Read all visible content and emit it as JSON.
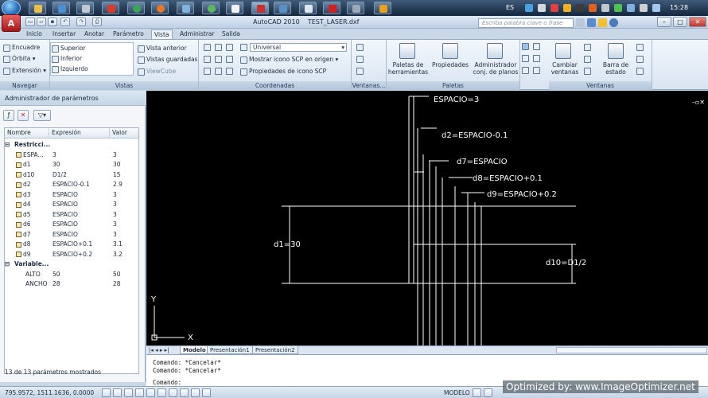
{
  "taskbar": {
    "language": "ES",
    "clock": "15:28"
  },
  "titlebar": {
    "title": "AutoCAD 2010    TEST_LASER.dxf",
    "search_placeholder": "Escriba palabra clave o frase",
    "app_letter": "A"
  },
  "ribbon_tabs": [
    "Inicio",
    "Insertar",
    "Anotar",
    "Parámetro",
    "Vista",
    "Administrar",
    "Salida"
  ],
  "ribbon": {
    "navegar": {
      "title": "Navegar",
      "items": [
        "Encuadre",
        "Órbita",
        "Extensión"
      ]
    },
    "vistas": {
      "title": "Vistas",
      "list": [
        "Superior",
        "Inferior",
        "Izquierdo"
      ],
      "items": [
        "Vista anterior",
        "Vistas guardadas",
        "ViewCube"
      ]
    },
    "coordenadas": {
      "title": "Coordenadas",
      "combo": "Universal",
      "items": [
        "Mostrar icono SCP en origen",
        "Propiedades de icono SCP"
      ]
    },
    "ventanas_small": {
      "title": "Ventanas..."
    },
    "paletas": {
      "title": "Paletas",
      "items": [
        "Paletas de herramientas",
        "Propiedades",
        "Administrador conj. de planos"
      ]
    },
    "ventanas": {
      "title": "Ventanas",
      "items": [
        "Cambiar ventanas",
        "Barra de estado"
      ]
    }
  },
  "palette": {
    "title": "Administrador de parámetros",
    "columns": [
      "Nombre",
      "Expresión",
      "Valor"
    ],
    "sections": [
      {
        "name": "Restricci...",
        "rows": [
          {
            "name": "ESPA...",
            "expr": "3",
            "value": "3"
          },
          {
            "name": "d1",
            "expr": "30",
            "value": "30"
          },
          {
            "name": "d10",
            "expr": "D1/2",
            "value": "15"
          },
          {
            "name": "d2",
            "expr": "ESPACIO-0.1",
            "value": "2.9"
          },
          {
            "name": "d3",
            "expr": "ESPACIO",
            "value": "3"
          },
          {
            "name": "d4",
            "expr": "ESPACIO",
            "value": "3"
          },
          {
            "name": "d5",
            "expr": "ESPACIO",
            "value": "3"
          },
          {
            "name": "d6",
            "expr": "ESPACIO",
            "value": "3"
          },
          {
            "name": "d7",
            "expr": "ESPACIO",
            "value": "3"
          },
          {
            "name": "d8",
            "expr": "ESPACIO+0.1",
            "value": "3.1"
          },
          {
            "name": "d9",
            "expr": "ESPACIO+0.2",
            "value": "3.2"
          }
        ]
      },
      {
        "name": "Variable...",
        "rows": [
          {
            "name": "ALTO",
            "expr": "50",
            "value": "50"
          },
          {
            "name": "ANCHO",
            "expr": "28",
            "value": "28"
          }
        ]
      }
    ],
    "status": "13 de 13 parámetros mostrados"
  },
  "drawing": {
    "dim_labels": [
      "ESPACIO=3",
      "d2=ESPACIO-0.1",
      "d7=ESPACIO",
      "d8=ESPACIO+0.1",
      "d9=ESPACIO+0.2",
      "d1=30",
      "d10=D1/2"
    ],
    "axis_x": "X",
    "axis_y": "Y"
  },
  "layout_tabs": [
    "Modelo",
    "Presentación1",
    "Presentación2"
  ],
  "command": {
    "lines": [
      "Comando: *Cancelar*",
      "Comando: *Cancelar*",
      "Comando:"
    ]
  },
  "statusbar": {
    "coords": "795.9572, 1511.1636, 0.0000",
    "model": "MODELO"
  },
  "watermark": "Optimized by: www.ImageOptimizer.net"
}
